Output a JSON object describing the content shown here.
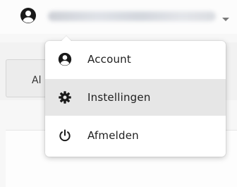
{
  "header": {
    "user_name": "",
    "user_icon": "user-circle-icon",
    "caret_icon": "caret-down-icon"
  },
  "background": {
    "partial_button_label": "Al"
  },
  "menu": {
    "items": [
      {
        "label": "Account",
        "icon": "user-circle-icon",
        "active": false
      },
      {
        "label": "Instellingen",
        "icon": "gear-icon",
        "active": true
      },
      {
        "label": "Afmelden",
        "icon": "power-icon",
        "active": false
      }
    ]
  },
  "colors": {
    "menu_bg": "#ffffff",
    "active_item_bg": "#e6e6e6",
    "icon": "#1a1a1a"
  }
}
